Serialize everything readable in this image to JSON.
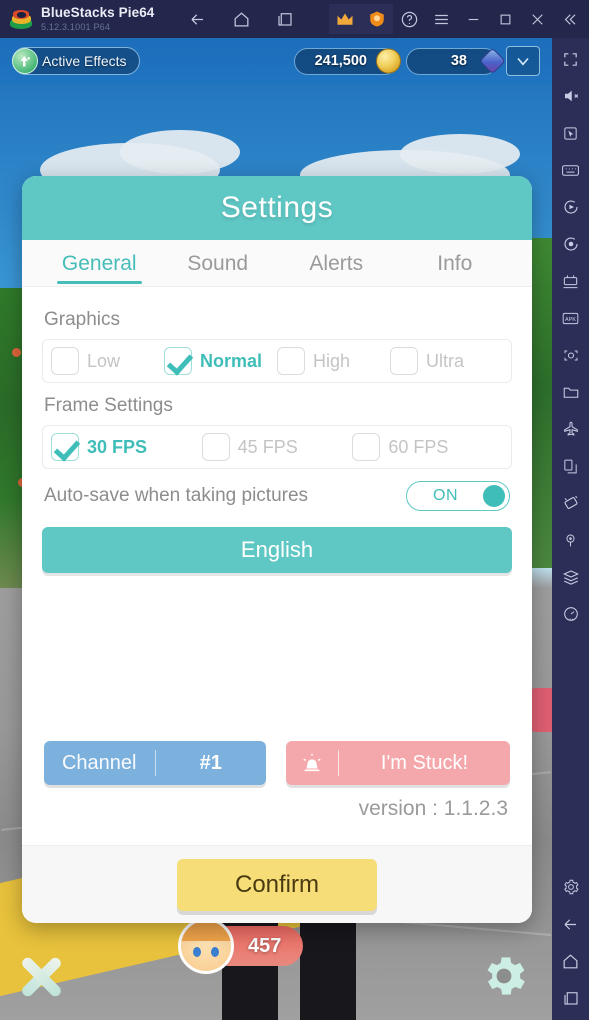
{
  "titlebar": {
    "app_name": "BlueStacks Pie64",
    "version": "5.12.3.1001  P64",
    "nav": [
      {
        "name": "back-icon",
        "label": "Back"
      },
      {
        "name": "home-icon",
        "label": "Home"
      },
      {
        "name": "recents-icon",
        "label": "Recent apps"
      }
    ],
    "right": [
      {
        "name": "crown-icon",
        "label": "Premium"
      },
      {
        "name": "shield-icon",
        "label": "Security"
      },
      {
        "name": "help-icon",
        "label": "Help"
      },
      {
        "name": "menu-icon",
        "label": "Menu"
      },
      {
        "name": "minimize-icon",
        "label": "Minimize"
      },
      {
        "name": "maximize-icon",
        "label": "Maximize"
      },
      {
        "name": "close-icon",
        "label": "Close"
      },
      {
        "name": "collapse-icon",
        "label": "Collapse"
      }
    ]
  },
  "game_hud": {
    "active_effects_label": "Active Effects",
    "gold": "241,500",
    "gems": "38",
    "dropdown_icon": "chevron-down-icon",
    "hp_value": "457"
  },
  "settings": {
    "title": "Settings",
    "tabs": [
      {
        "label": "General",
        "active": true
      },
      {
        "label": "Sound",
        "active": false
      },
      {
        "label": "Alerts",
        "active": false
      },
      {
        "label": "Info",
        "active": false
      }
    ],
    "graphics": {
      "label": "Graphics",
      "options": [
        {
          "label": "Low",
          "checked": false
        },
        {
          "label": "Normal",
          "checked": true
        },
        {
          "label": "High",
          "checked": false
        },
        {
          "label": "Ultra",
          "checked": false
        }
      ]
    },
    "frame": {
      "label": "Frame Settings",
      "options": [
        {
          "label": "30 FPS",
          "checked": true
        },
        {
          "label": "45 FPS",
          "checked": false
        },
        {
          "label": "60 FPS",
          "checked": false
        }
      ]
    },
    "autosave": {
      "label": "Auto-save when taking pictures",
      "state": "ON"
    },
    "language_button": "English",
    "channel": {
      "label": "Channel",
      "value": "#1"
    },
    "stuck_button": "I'm Stuck!",
    "version_text": "version : 1.1.2.3",
    "confirm_button": "Confirm"
  },
  "sidebar": {
    "items": [
      {
        "name": "fullscreen-icon",
        "label": "Fullscreen"
      },
      {
        "name": "mute-icon",
        "label": "Mute"
      },
      {
        "name": "pointer-icon",
        "label": "Cursor"
      },
      {
        "name": "keyboard-icon",
        "label": "Game controls"
      },
      {
        "name": "macro-play-icon",
        "label": "Macro"
      },
      {
        "name": "record-icon",
        "label": "Record"
      },
      {
        "name": "multi-instance-icon",
        "label": "Multi-instance"
      },
      {
        "name": "apk-install-icon",
        "label": "Install APK"
      },
      {
        "name": "screenshot-icon",
        "label": "Screenshot"
      },
      {
        "name": "folder-icon",
        "label": "Media manager"
      },
      {
        "name": "airplane-icon",
        "label": "Eco mode"
      },
      {
        "name": "copy-icon",
        "label": "Clipboard"
      },
      {
        "name": "rotate-icon",
        "label": "Rotate"
      },
      {
        "name": "location-icon",
        "label": "Location"
      },
      {
        "name": "layers-icon",
        "label": "Layers"
      },
      {
        "name": "speedometer-icon",
        "label": "Performance"
      }
    ],
    "bottom_items": [
      {
        "name": "gear-icon",
        "label": "Settings"
      },
      {
        "name": "back-icon",
        "label": "Back"
      },
      {
        "name": "home-icon",
        "label": "Home"
      },
      {
        "name": "recents-icon",
        "label": "Recents"
      }
    ]
  },
  "colors": {
    "teal": "#5fc7c4",
    "teal_text": "#3fbdb8",
    "yellow": "#f7dd77",
    "blue_button": "#7cb0dd",
    "pink_button": "#f4a8ab",
    "titlebar": "#23274b",
    "hud_blue": "#1f74c0"
  }
}
